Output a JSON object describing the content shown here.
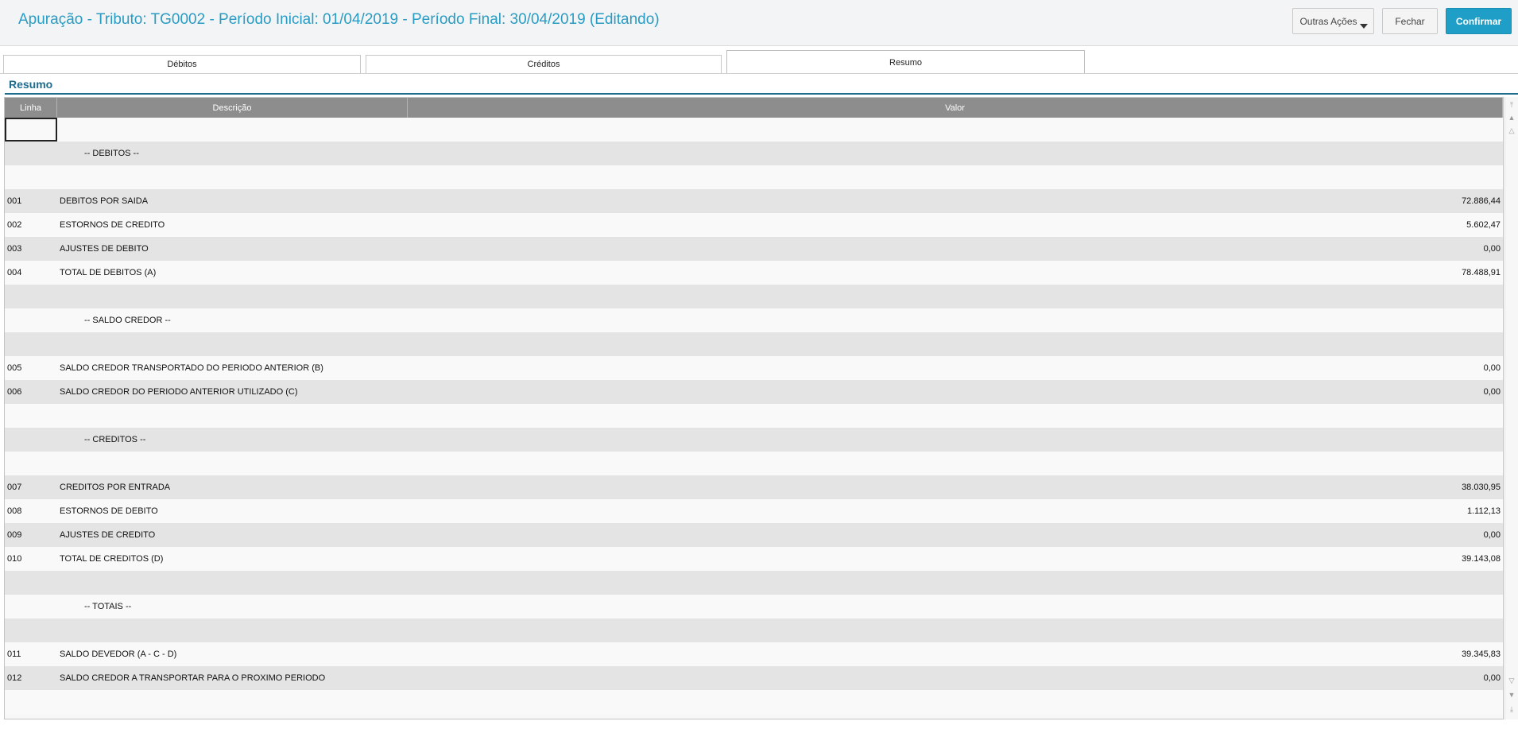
{
  "header": {
    "title": "Apuração - Tributo: TG0002 - Período Inicial: 01/04/2019 - Período Final: 30/04/2019 (Editando)",
    "buttons": {
      "outras": "Outras Ações",
      "fechar": "Fechar",
      "confirmar": "Confirmar"
    }
  },
  "tabs": {
    "debitos": "Débitos",
    "creditos": "Créditos",
    "resumo": "Resumo"
  },
  "section_title": "Resumo",
  "grid": {
    "columns": {
      "linha": "Linha",
      "descricao": "Descrição",
      "valor": "Valor"
    },
    "rows": [
      {
        "linha": "",
        "descricao": "",
        "valor": "",
        "section": false
      },
      {
        "linha": "",
        "descricao": "-- DEBITOS --",
        "valor": "",
        "section": true
      },
      {
        "linha": "",
        "descricao": "",
        "valor": "",
        "section": false
      },
      {
        "linha": "001",
        "descricao": "DEBITOS POR SAIDA",
        "valor": "72.886,44",
        "section": false
      },
      {
        "linha": "002",
        "descricao": "ESTORNOS DE CREDITO",
        "valor": "5.602,47",
        "section": false
      },
      {
        "linha": "003",
        "descricao": "AJUSTES DE DEBITO",
        "valor": "0,00",
        "section": false
      },
      {
        "linha": "004",
        "descricao": "TOTAL DE DEBITOS (A)",
        "valor": "78.488,91",
        "section": false
      },
      {
        "linha": "",
        "descricao": "",
        "valor": "",
        "section": false
      },
      {
        "linha": "",
        "descricao": "-- SALDO CREDOR --",
        "valor": "",
        "section": true
      },
      {
        "linha": "",
        "descricao": "",
        "valor": "",
        "section": false
      },
      {
        "linha": "005",
        "descricao": "SALDO CREDOR TRANSPORTADO DO PERIODO ANTERIOR (B)",
        "valor": "0,00",
        "section": false
      },
      {
        "linha": "006",
        "descricao": "SALDO CREDOR DO PERIODO ANTERIOR UTILIZADO (C)",
        "valor": "0,00",
        "section": false
      },
      {
        "linha": "",
        "descricao": "",
        "valor": "",
        "section": false
      },
      {
        "linha": "",
        "descricao": "-- CREDITOS --",
        "valor": "",
        "section": true
      },
      {
        "linha": "",
        "descricao": "",
        "valor": "",
        "section": false
      },
      {
        "linha": "007",
        "descricao": "CREDITOS POR ENTRADA",
        "valor": "38.030,95",
        "section": false
      },
      {
        "linha": "008",
        "descricao": "ESTORNOS DE DEBITO",
        "valor": "1.112,13",
        "section": false
      },
      {
        "linha": "009",
        "descricao": "AJUSTES DE CREDITO",
        "valor": "0,00",
        "section": false
      },
      {
        "linha": "010",
        "descricao": "TOTAL DE CREDITOS (D)",
        "valor": "39.143,08",
        "section": false
      },
      {
        "linha": "",
        "descricao": "",
        "valor": "",
        "section": false
      },
      {
        "linha": "",
        "descricao": "-- TOTAIS --",
        "valor": "",
        "section": true
      },
      {
        "linha": "",
        "descricao": "",
        "valor": "",
        "section": false
      },
      {
        "linha": "011",
        "descricao": "SALDO DEVEDOR (A - C - D)",
        "valor": "39.345,83",
        "section": false
      },
      {
        "linha": "012",
        "descricao": "SALDO CREDOR A TRANSPORTAR PARA O PROXIMO PERIODO",
        "valor": "0,00",
        "section": false
      },
      {
        "linha": "",
        "descricao": "",
        "valor": "",
        "section": false
      }
    ]
  },
  "scrollbar": {
    "top_icon": "scroll-top-icon",
    "page_up_icon": "page-up-icon",
    "up_icon": "scroll-up-icon",
    "down_icon": "scroll-down-icon",
    "page_down_icon": "page-down-icon",
    "bottom_icon": "scroll-bottom-icon"
  }
}
